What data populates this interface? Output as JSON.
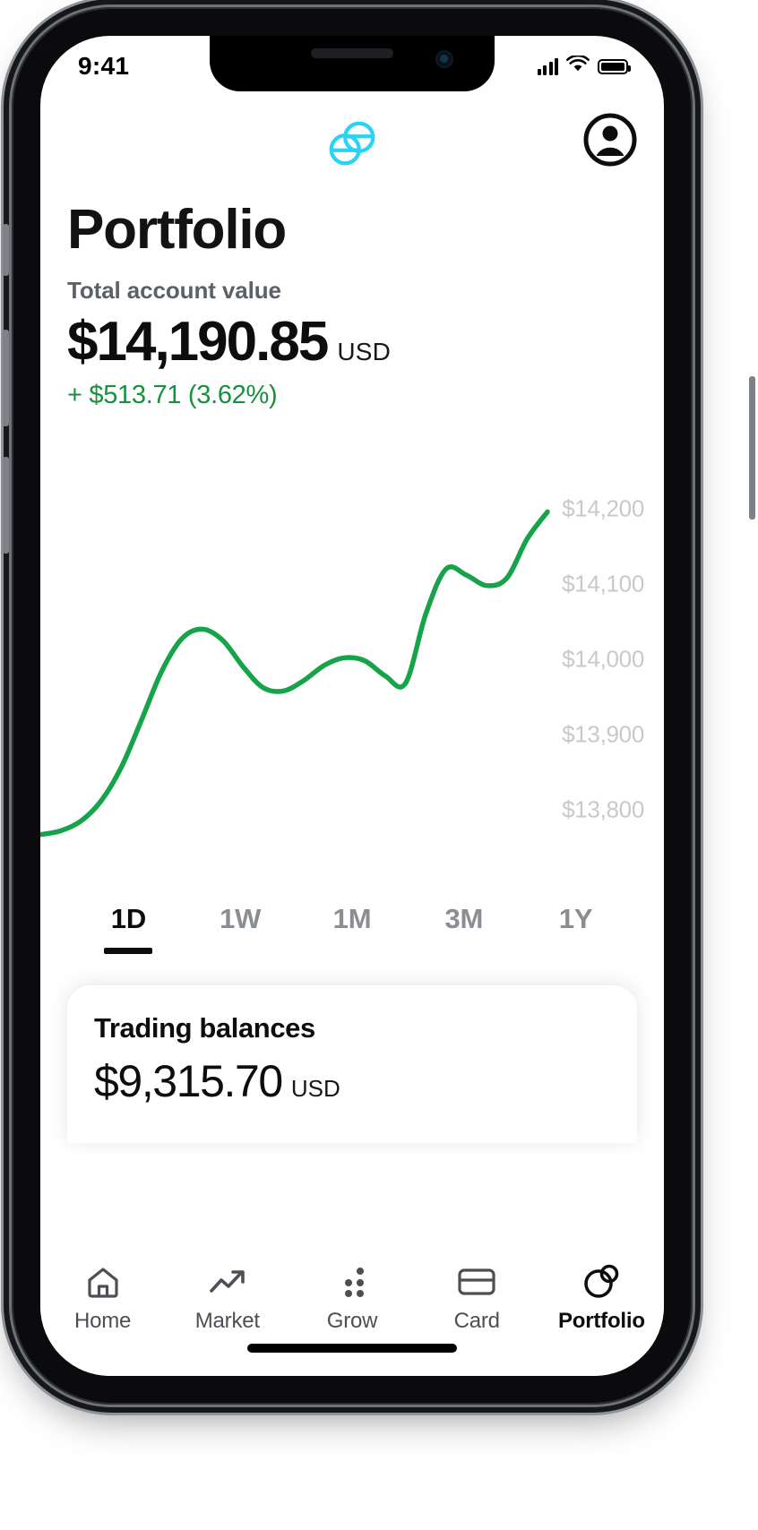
{
  "status_bar": {
    "time": "9:41",
    "cellular_icon": "signal-bars-icon",
    "wifi_icon": "wifi-icon",
    "battery_icon": "battery-full-icon"
  },
  "header": {
    "logo_icon": "gemini-logo-icon",
    "logo_color": "#2ad2f5",
    "account_icon": "account-avatar-icon"
  },
  "page": {
    "title": "Portfolio",
    "total_label": "Total account value",
    "total_value": "$14,190.85",
    "total_currency": "USD",
    "delta_text": "+ $513.71 (3.62%)",
    "delta_color": "#17913d"
  },
  "chart_data": {
    "type": "line",
    "title": "",
    "xlabel": "",
    "ylabel": "",
    "line_color": "#16a34a",
    "grid": false,
    "legend": "none",
    "ylim": [
      13750,
      14250
    ],
    "ytick_labels": [
      "$14,200",
      "$14,100",
      "$14,000",
      "$13,900",
      "$13,800"
    ],
    "yticks": [
      14200,
      14100,
      14000,
      13900,
      13800
    ],
    "x": [
      0,
      4,
      8,
      12,
      16,
      20,
      24,
      28,
      32,
      36,
      40,
      44,
      48,
      52,
      56,
      60,
      64,
      68,
      72,
      76,
      80,
      84,
      88,
      92,
      96,
      100
    ],
    "values": [
      13767,
      13772,
      13785,
      13812,
      13857,
      13920,
      13985,
      14028,
      14040,
      14025,
      13990,
      13962,
      13958,
      13972,
      13992,
      14002,
      13998,
      13978,
      13968,
      14060,
      14120,
      14112,
      14098,
      14108,
      14160,
      14196
    ]
  },
  "range_tabs": {
    "active": "1D",
    "items": [
      {
        "label": "1D"
      },
      {
        "label": "1W"
      },
      {
        "label": "1M"
      },
      {
        "label": "3M"
      },
      {
        "label": "1Y"
      }
    ]
  },
  "trading_balances": {
    "title": "Trading balances",
    "value": "$9,315.70",
    "currency": "USD"
  },
  "tabbar": {
    "active": "Portfolio",
    "items": [
      {
        "label": "Home",
        "icon": "home-icon"
      },
      {
        "label": "Market",
        "icon": "trending-up-icon"
      },
      {
        "label": "Grow",
        "icon": "grow-dots-icon"
      },
      {
        "label": "Card",
        "icon": "credit-card-icon"
      },
      {
        "label": "Portfolio",
        "icon": "portfolio-circles-icon"
      }
    ]
  }
}
